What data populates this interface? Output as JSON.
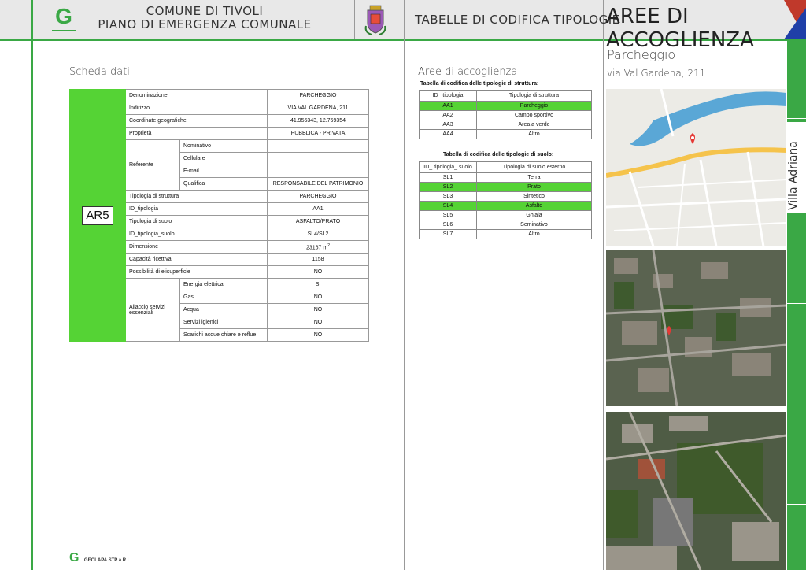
{
  "header": {
    "logo_letter": "G",
    "title_line1": "COMUNE DI TIVOLI",
    "title_line2": "PIANO DI EMERGENZA COMUNALE",
    "tabelle": "TABELLE DI CODIFICA TIPOLOGIE",
    "aree": "AREE DI ACCOGLIENZA"
  },
  "left": {
    "section_title": "Scheda dati",
    "code": "AR5",
    "rows": {
      "denominazione": {
        "label": "Denominazione",
        "value": "PARCHEGGIO"
      },
      "indirizzo": {
        "label": "Indirizzo",
        "value": "VIA VAL GARDENA, 211"
      },
      "coordinate": {
        "label": "Coordinate geografiche",
        "value": "41.956343, 12.769354"
      },
      "proprieta": {
        "label": "Proprietà",
        "value": "PUBBLICA - PRIVATA"
      },
      "referente": {
        "label": "Referente",
        "nominativo": "Nominativo",
        "cellulare": "Cellulare",
        "email": "E-mail",
        "qualifica": "Qualifica",
        "qualifica_value": "RESPONSABILE DEL PATRIMONIO"
      },
      "tipologia_struttura": {
        "label": "Tipologia di struttura",
        "value": "PARCHEGGIO"
      },
      "id_tipologia": {
        "label": "ID_tipologia",
        "value": "AA1"
      },
      "tipologia_suolo": {
        "label": "Tipologia di suolo",
        "value": "ASFALTO/PRATO"
      },
      "id_tipologia_suolo": {
        "label": "ID_tipologia_suolo",
        "value": "SL4/SL2"
      },
      "dimensione": {
        "label": "Dimensione",
        "value": "23167 m",
        "unit_sup": "2"
      },
      "capacita": {
        "label": "Capacità ricettiva",
        "value": "1158"
      },
      "elisuperficie": {
        "label": "Possibilità di elisuperficie",
        "value": "NO"
      },
      "allaccio": {
        "label": "Allaccio servizi essenziali",
        "energia": {
          "label": "Energia elettrica",
          "value": "SI"
        },
        "gas": {
          "label": "Gas",
          "value": "NO"
        },
        "acqua": {
          "label": "Acqua",
          "value": "NO"
        },
        "servizi": {
          "label": "Servizi igienici",
          "value": "NO"
        },
        "scarichi": {
          "label": "Scarichi acque chiare e reflue",
          "value": "NO"
        }
      }
    },
    "footer_company": "GEOLAPA STP  a R.L."
  },
  "middle": {
    "section_title": "Aree di accoglienza",
    "struttura": {
      "caption": "Tabella di codifica delle tipologie di struttura:",
      "headers": [
        "ID_ tipologia",
        "Tipologia di struttura"
      ],
      "rows": [
        {
          "id": "AA1",
          "name": "Parcheggio",
          "hl": true
        },
        {
          "id": "AA2",
          "name": "Campo sportivo",
          "hl": false
        },
        {
          "id": "AA3",
          "name": "Area a verde",
          "hl": false
        },
        {
          "id": "AA4",
          "name": "Altro",
          "hl": false
        }
      ]
    },
    "suolo": {
      "caption": "Tabella di codifica delle tipologie di suolo:",
      "headers": [
        "ID_ tipologia_ suolo",
        "Tipologia di suolo esterno"
      ],
      "rows": [
        {
          "id": "SL1",
          "name": "Terra",
          "hl": false
        },
        {
          "id": "SL2",
          "name": "Prato",
          "hl": true
        },
        {
          "id": "SL3",
          "name": "Sintetico",
          "hl": false
        },
        {
          "id": "SL4",
          "name": "Asfalto",
          "hl": true
        },
        {
          "id": "SL5",
          "name": "Ghiaia",
          "hl": false
        },
        {
          "id": "SL6",
          "name": "Seminativo",
          "hl": false
        },
        {
          "id": "SL7",
          "name": "Altro",
          "hl": false
        }
      ]
    }
  },
  "right": {
    "place_title": "Parcheggio",
    "place_address": "via Val Gardena, 211",
    "side_label": "Villa Adriana"
  },
  "colors": {
    "accent_green": "#3aa845",
    "highlight_green": "#55d335",
    "red": "#c0392b",
    "blue": "#1f3fa8"
  }
}
